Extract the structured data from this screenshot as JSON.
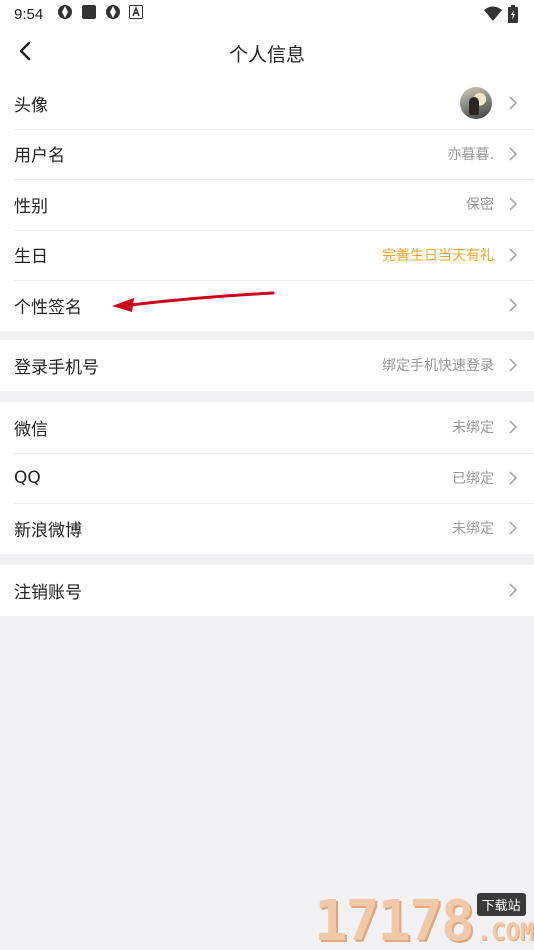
{
  "status_bar": {
    "time": "9:54",
    "icons": [
      "app-icon",
      "square-icon",
      "app-icon",
      "a-icon"
    ],
    "right_icons": [
      "wifi-icon",
      "battery-icon"
    ]
  },
  "nav": {
    "title": "个人信息",
    "back_icon": "chevron-left-icon"
  },
  "groups": [
    {
      "rows": [
        {
          "label": "头像",
          "value": "",
          "type": "avatar"
        },
        {
          "label": "用户名",
          "value": "亦暮暮."
        },
        {
          "label": "性别",
          "value": "保密"
        },
        {
          "label": "生日",
          "value": "完善生日当天有礼",
          "accent": true
        },
        {
          "label": "个性签名",
          "value": ""
        }
      ]
    },
    {
      "rows": [
        {
          "label": "登录手机号",
          "value": "绑定手机快速登录"
        }
      ]
    },
    {
      "rows": [
        {
          "label": "微信",
          "value": "未绑定"
        },
        {
          "label": "QQ",
          "value": "已绑定"
        },
        {
          "label": "新浪微博",
          "value": "未绑定"
        }
      ]
    },
    {
      "rows": [
        {
          "label": "注销账号",
          "value": ""
        }
      ]
    }
  ],
  "colors": {
    "accent": "#f5a623",
    "annotation_arrow": "#d0021b"
  },
  "watermark": {
    "number": "17178",
    "badge": "下载站",
    "suffix": ".COM"
  }
}
